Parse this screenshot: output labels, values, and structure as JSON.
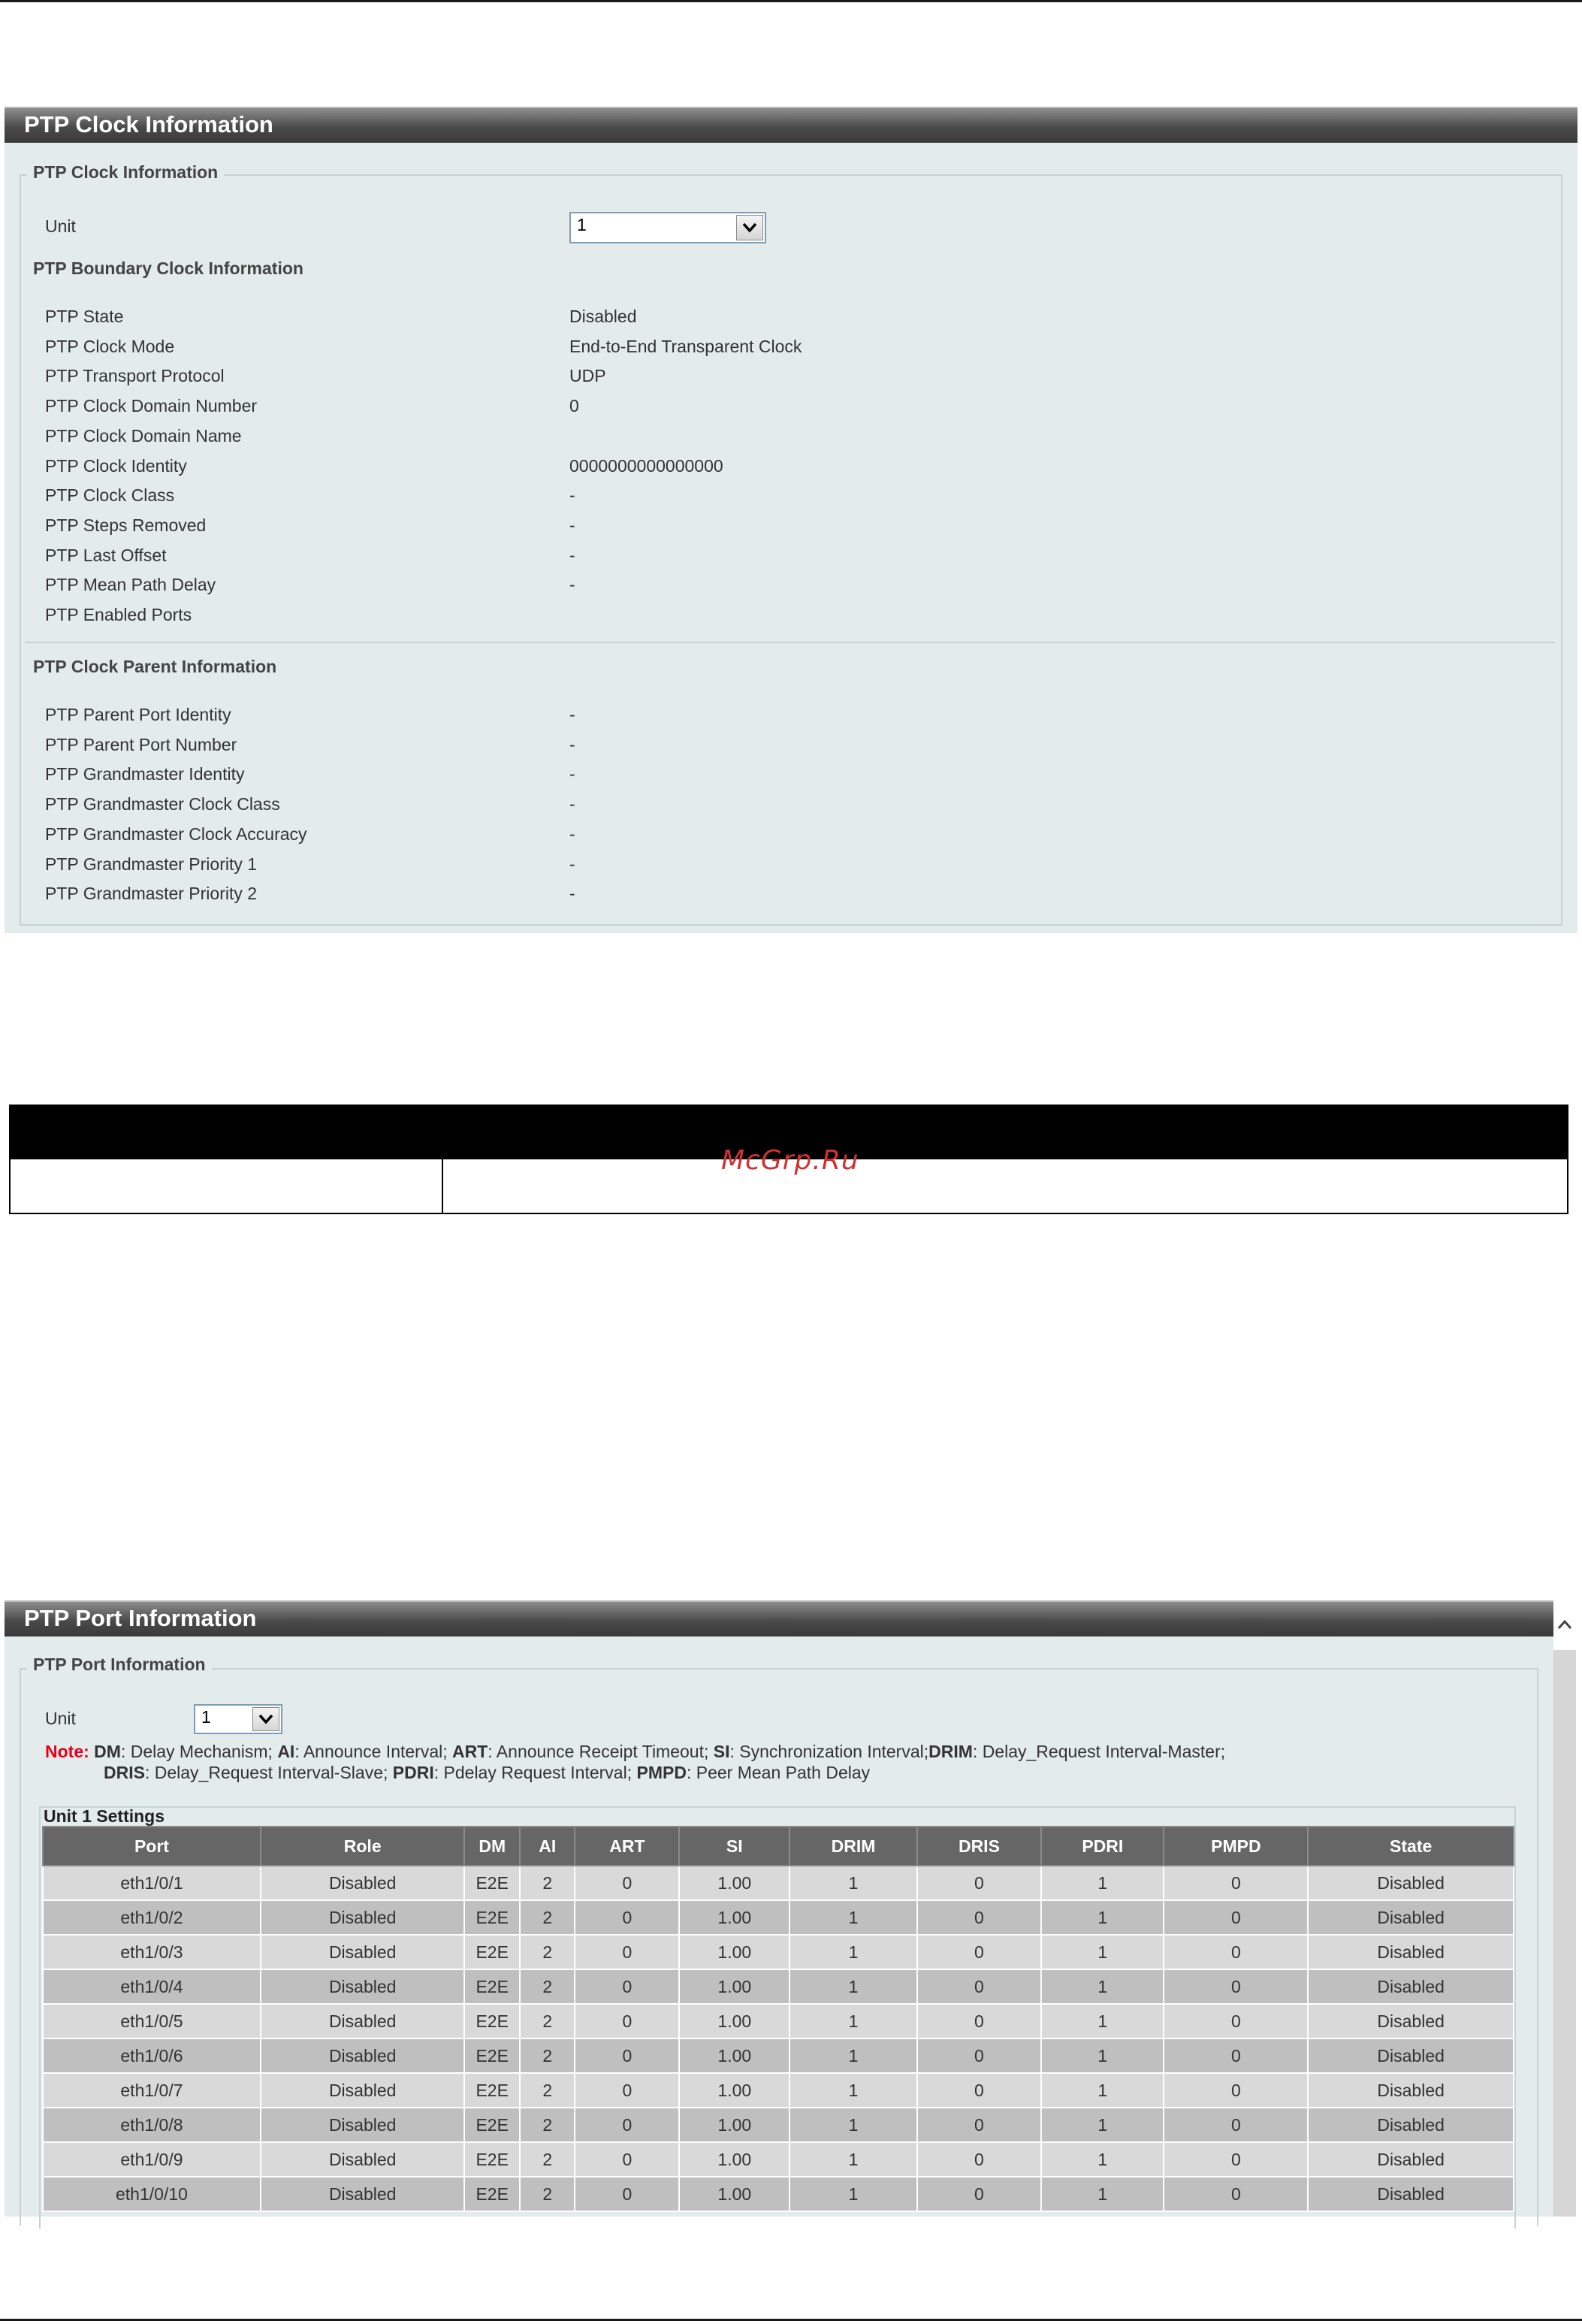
{
  "clock_panel": {
    "title": "PTP Clock Information",
    "fieldset_legend": "PTP Clock Information",
    "unit_label": "Unit",
    "unit_value": "1",
    "boundary_heading": "PTP Boundary Clock Information",
    "boundary_rows": [
      {
        "label": "PTP State",
        "value": "Disabled"
      },
      {
        "label": "PTP Clock Mode",
        "value": "End-to-End Transparent Clock"
      },
      {
        "label": "PTP Transport Protocol",
        "value": "UDP"
      },
      {
        "label": "PTP Clock Domain Number",
        "value": "0"
      },
      {
        "label": "PTP Clock Domain Name",
        "value": ""
      },
      {
        "label": "PTP Clock Identity",
        "value": "0000000000000000"
      },
      {
        "label": "PTP Clock Class",
        "value": "-"
      },
      {
        "label": "PTP Steps Removed",
        "value": "-"
      },
      {
        "label": "PTP Last Offset",
        "value": "-"
      },
      {
        "label": "PTP Mean Path Delay",
        "value": "-"
      },
      {
        "label": "PTP Enabled Ports",
        "value": ""
      }
    ],
    "parent_heading": "PTP Clock Parent Information",
    "parent_rows": [
      {
        "label": "PTP Parent Port Identity",
        "value": "-"
      },
      {
        "label": "PTP Parent Port Number",
        "value": "-"
      },
      {
        "label": "PTP Grandmaster Identity",
        "value": "-"
      },
      {
        "label": "PTP Grandmaster Clock Class",
        "value": "-"
      },
      {
        "label": "PTP Grandmaster Clock Accuracy",
        "value": "-"
      },
      {
        "label": "PTP Grandmaster Priority 1",
        "value": "-"
      },
      {
        "label": "PTP Grandmaster Priority 2",
        "value": "-"
      }
    ]
  },
  "watermark": "McGrp.Ru",
  "port_panel": {
    "title": "PTP Port Information",
    "fieldset_legend": "PTP Port Information",
    "unit_label": "Unit",
    "unit_value": "1",
    "note_label": "Note:",
    "note_line1": [
      {
        "abbr": "DM",
        "text": ": Delay Mechanism; "
      },
      {
        "abbr": "AI",
        "text": ": Announce Interval; "
      },
      {
        "abbr": "ART",
        "text": ": Announce Receipt Timeout; "
      },
      {
        "abbr": "SI",
        "text": ": Synchronization Interval;"
      },
      {
        "abbr": "DRIM",
        "text": ": Delay_Request Interval-Master;"
      }
    ],
    "note_line2": [
      {
        "abbr": "DRIS",
        "text": ": Delay_Request Interval-Slave; "
      },
      {
        "abbr": "PDRI",
        "text": ": Pdelay Request Interval; "
      },
      {
        "abbr": "PMPD",
        "text": ": Peer Mean Path Delay"
      }
    ],
    "table_caption": "Unit 1 Settings",
    "columns": [
      "Port",
      "Role",
      "DM",
      "AI",
      "ART",
      "SI",
      "DRIM",
      "DRIS",
      "PDRI",
      "PMPD",
      "State"
    ],
    "rows": [
      [
        "eth1/0/1",
        "Disabled",
        "E2E",
        "2",
        "0",
        "1.00",
        "1",
        "0",
        "1",
        "0",
        "Disabled"
      ],
      [
        "eth1/0/2",
        "Disabled",
        "E2E",
        "2",
        "0",
        "1.00",
        "1",
        "0",
        "1",
        "0",
        "Disabled"
      ],
      [
        "eth1/0/3",
        "Disabled",
        "E2E",
        "2",
        "0",
        "1.00",
        "1",
        "0",
        "1",
        "0",
        "Disabled"
      ],
      [
        "eth1/0/4",
        "Disabled",
        "E2E",
        "2",
        "0",
        "1.00",
        "1",
        "0",
        "1",
        "0",
        "Disabled"
      ],
      [
        "eth1/0/5",
        "Disabled",
        "E2E",
        "2",
        "0",
        "1.00",
        "1",
        "0",
        "1",
        "0",
        "Disabled"
      ],
      [
        "eth1/0/6",
        "Disabled",
        "E2E",
        "2",
        "0",
        "1.00",
        "1",
        "0",
        "1",
        "0",
        "Disabled"
      ],
      [
        "eth1/0/7",
        "Disabled",
        "E2E",
        "2",
        "0",
        "1.00",
        "1",
        "0",
        "1",
        "0",
        "Disabled"
      ],
      [
        "eth1/0/8",
        "Disabled",
        "E2E",
        "2",
        "0",
        "1.00",
        "1",
        "0",
        "1",
        "0",
        "Disabled"
      ],
      [
        "eth1/0/9",
        "Disabled",
        "E2E",
        "2",
        "0",
        "1.00",
        "1",
        "0",
        "1",
        "0",
        "Disabled"
      ],
      [
        "eth1/0/10",
        "Disabled",
        "E2E",
        "2",
        "0",
        "1.00",
        "1",
        "0",
        "1",
        "0",
        "Disabled"
      ]
    ]
  }
}
